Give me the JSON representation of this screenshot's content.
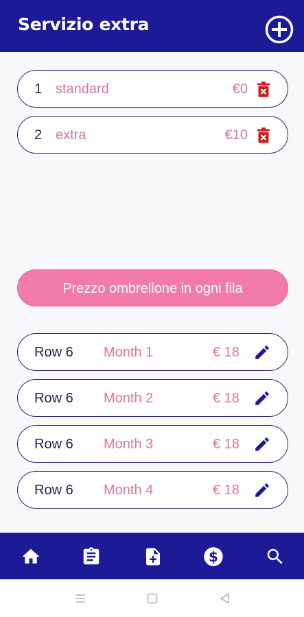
{
  "header": {
    "title": "Servizio extra",
    "add_icon": "add-circle-icon"
  },
  "services": [
    {
      "number": "1",
      "name": "standard",
      "price": "€0",
      "icon": "delete-icon"
    },
    {
      "number": "2",
      "name": "extra",
      "price": "€10",
      "icon": "delete-icon"
    }
  ],
  "price_button": {
    "label": "Prezzo ombrellone in ogni fila"
  },
  "rows": [
    {
      "row": "Row 6",
      "month": "Month 1",
      "price": "€ 18",
      "icon": "edit-icon"
    },
    {
      "row": "Row 6",
      "month": "Month 2",
      "price": "€ 18",
      "icon": "edit-icon"
    },
    {
      "row": "Row 6",
      "month": "Month 3",
      "price": "€ 18",
      "icon": "edit-icon"
    },
    {
      "row": "Row 6",
      "month": "Month 4",
      "price": "€ 18",
      "icon": "edit-icon"
    }
  ],
  "bottom_nav": [
    "home-icon",
    "clipboard-icon",
    "add-document-icon",
    "dollar-icon",
    "search-icon"
  ],
  "system_nav": [
    "menu-icon",
    "home-square-icon",
    "back-icon"
  ],
  "colors": {
    "primary": "#1d1a97",
    "accent_pink": "#f27ca7",
    "text_pink": "#e0749e",
    "delete_red": "#cc1f1f"
  }
}
